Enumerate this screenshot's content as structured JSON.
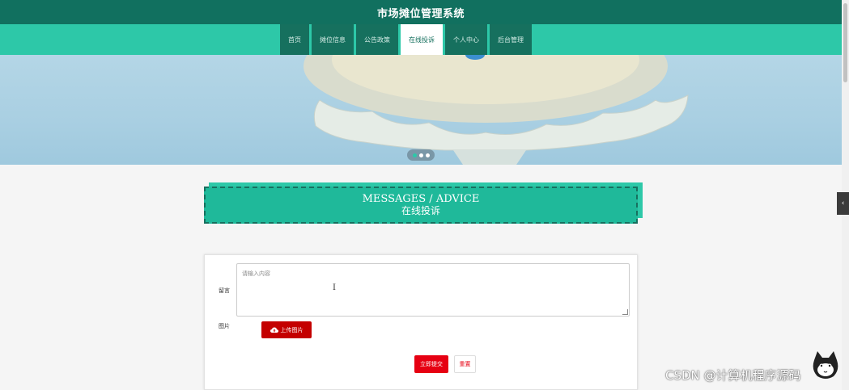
{
  "header": {
    "title": "市场摊位管理系统"
  },
  "nav": {
    "items": [
      {
        "label": "首页"
      },
      {
        "label": "摊位信息"
      },
      {
        "label": "公告政策"
      },
      {
        "label": "在线投诉"
      },
      {
        "label": "个人中心"
      },
      {
        "label": "后台管理"
      }
    ],
    "active_index": 3
  },
  "banner": {
    "slide_count": 3,
    "active_slide": 1
  },
  "section": {
    "title_en": "MESSAGES / ADVICE",
    "title_cn": "在线投诉"
  },
  "form": {
    "message_label": "留言",
    "message_placeholder": "请输入内容",
    "image_label": "图片",
    "upload_label": "上传图片",
    "submit_label": "立即提交",
    "reset_label": "重置"
  },
  "watermark": {
    "text": "CSDN @计算机程序源码"
  },
  "colors": {
    "title_bar": "#11705f",
    "nav_bar": "#2dc8a8",
    "nav_item": "#16705e",
    "upload_button": "#c40000",
    "submit_button": "#e60012"
  }
}
